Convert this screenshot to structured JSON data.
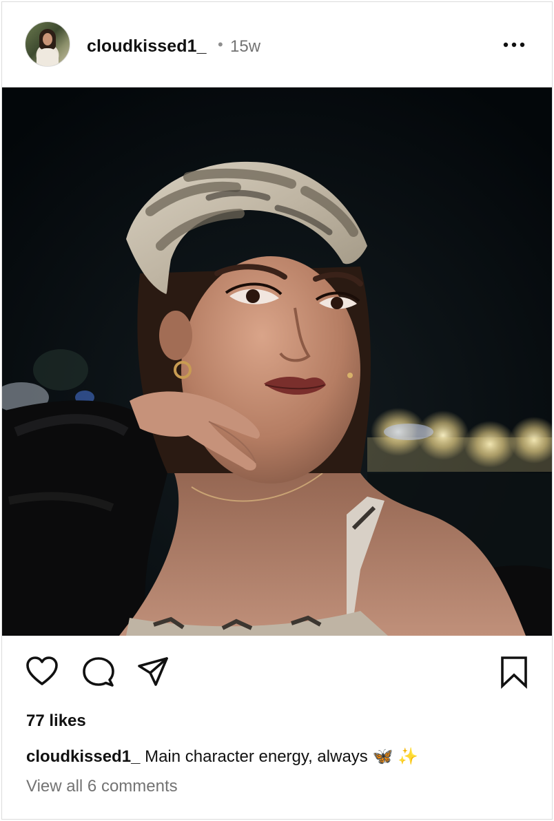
{
  "post": {
    "username": "cloudkissed1_",
    "separator": "•",
    "time_ago": "15w",
    "avatar_alt": "profile-avatar",
    "photo_subject": "selfie-at-night-fair",
    "likes_text": "77 likes",
    "caption": {
      "username": "cloudkissed1_",
      "text": "Main character energy, always",
      "emoji_1": "🦋",
      "emoji_2": "✨"
    },
    "view_comments_text": "View all 6 comments"
  },
  "icons": {
    "more": "more-options-icon",
    "like": "heart-icon",
    "comment": "comment-icon",
    "share": "paper-plane-icon",
    "save": "bookmark-icon"
  },
  "colors": {
    "text_primary": "#111111",
    "text_secondary": "#737373",
    "border": "#dbdbdb",
    "background": "#ffffff"
  }
}
